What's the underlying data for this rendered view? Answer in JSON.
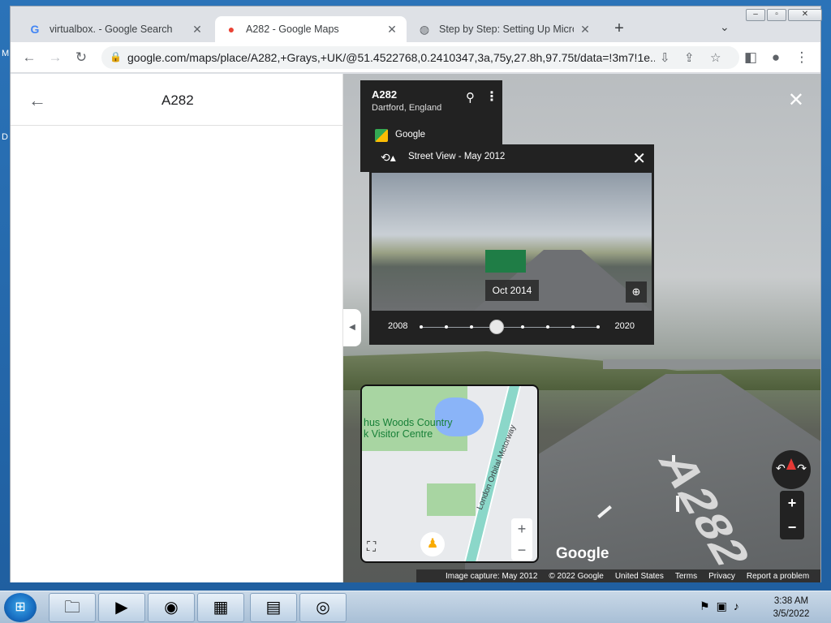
{
  "desktop": {
    "label_m": "M",
    "label_d": "D"
  },
  "browser": {
    "tabs": [
      {
        "title": "virtualbox. - Google Search",
        "favicon": "google-icon"
      },
      {
        "title": "A282 - Google Maps",
        "favicon": "maps-pin-icon"
      },
      {
        "title": "Step by Step: Setting Up Microsoft",
        "favicon": "globe-icon"
      }
    ],
    "url": "google.com/maps/place/A282,+Grays,+UK/@51.4522768,0.2410347,3a,75y,27.8h,97.75t/data=!3m7!1e..."
  },
  "left_panel": {
    "title": "A282"
  },
  "place_card": {
    "title": "A282",
    "subtitle": "Dartford, England",
    "brand": "Google"
  },
  "time_machine": {
    "title": "Street View - May 2012",
    "date_label": "Oct 2014",
    "start_year": "2008",
    "end_year": "2020",
    "position_index": 3,
    "snapshot_count": 8
  },
  "minimap": {
    "label_line1": "hus Woods Country",
    "label_line2": "k Visitor Centre",
    "road_label": "London Orbital Motorway"
  },
  "street_view": {
    "road_marking": "A282",
    "google_mark": "Google"
  },
  "footer": {
    "image_capture": "Image capture: May 2012",
    "copyright": "© 2022 Google",
    "country": "United States",
    "terms": "Terms",
    "privacy": "Privacy",
    "report": "Report a problem"
  },
  "taskbar": {
    "time": "3:38 AM",
    "date": "3/5/2022"
  },
  "colors": {
    "accent": "#1a73e8",
    "panel": "#222222",
    "motorway": "#8bd7c9"
  }
}
